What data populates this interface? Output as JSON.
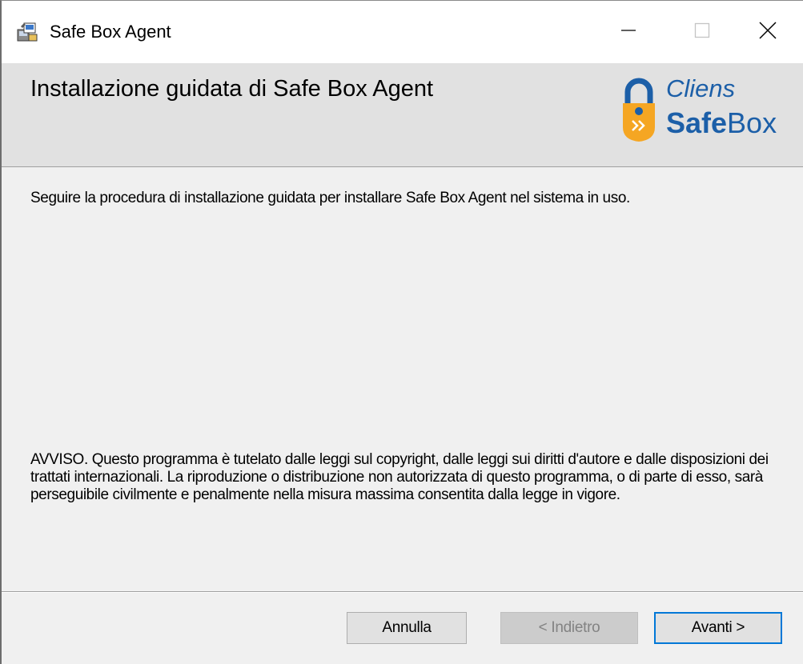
{
  "window": {
    "title": "Safe Box Agent",
    "app_icon": "installer-icon",
    "controls": {
      "minimize_icon": "minimize-icon",
      "maximize_icon": "maximize-icon",
      "close_icon": "close-icon"
    }
  },
  "banner": {
    "title": "Installazione guidata di Safe Box Agent",
    "logo": {
      "brand_top": "Cliens",
      "brand_bottom_bold": "Safe",
      "brand_bottom_light": "Box",
      "lock_icon": "padlock-icon",
      "colors": {
        "blue": "#1c5fa8",
        "orange": "#f5a623"
      }
    }
  },
  "body": {
    "intro": "Seguire la procedura di installazione guidata per installare Safe Box Agent nel sistema in uso.",
    "warning": "AVVISO. Questo programma è tutelato dalle leggi sul copyright, dalle leggi sui diritti d'autore e dalle disposizioni dei trattati internazionali. La riproduzione o distribuzione non autorizzata di questo programma, o di parte di esso, sarà perseguibile civilmente e penalmente nella misura massima consentita dalla legge in vigore."
  },
  "footer": {
    "cancel_label": "Annulla",
    "back_label": "< Indietro",
    "next_label": "Avanti >",
    "back_disabled": true,
    "accent_color": "#0078d7"
  }
}
